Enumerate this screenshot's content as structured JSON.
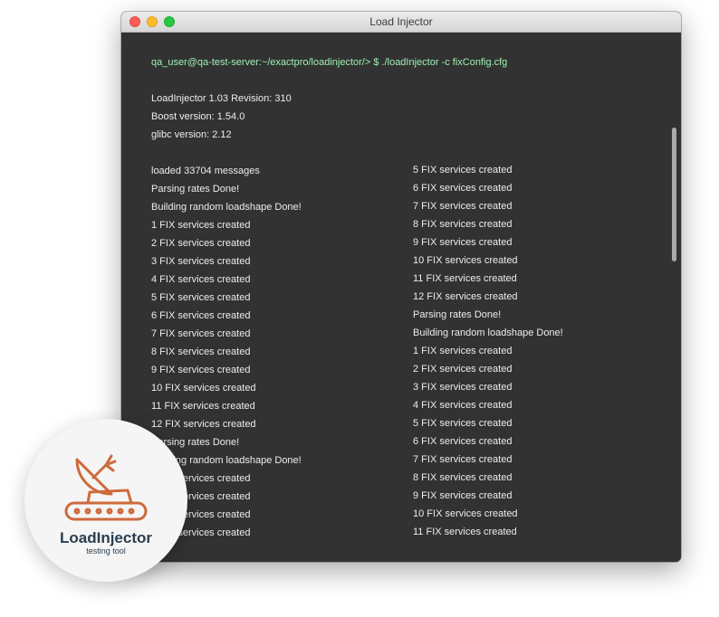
{
  "window": {
    "title": "Load Injector"
  },
  "terminal": {
    "prompt": "qa_user@qa-test-server:~/exactpro/loadinjector/> $ ./loadInjector -c fixConfig.cfg",
    "info": [
      "LoadInjector 1.03 Revision: 310",
      "Boost version: 1.54.0",
      "glibc version: 2.12"
    ],
    "left_column": [
      "loaded 33704 messages",
      "Parsing rates Done!",
      "Building random loadshape Done!",
      "1 FIX services created",
      "2 FIX services created",
      "3 FIX services created",
      "4 FIX services created",
      "5 FIX services created",
      "6 FIX services created",
      "7 FIX services created",
      "8 FIX services created",
      "9 FIX services created",
      "10 FIX services created",
      "11 FIX services created",
      "12 FIX services created",
      "Parsing rates Done!",
      "Building random loadshape Done!",
      "1 FIX services created",
      "2 FIX services created",
      "3 FIX services created",
      "4 FIX services created"
    ],
    "right_column": [
      "5 FIX services created",
      "6 FIX services created",
      "7 FIX services created",
      "8 FIX services created",
      "9 FIX services created",
      "10 FIX services created",
      "11 FIX services created",
      "12 FIX services created",
      "Parsing rates Done!",
      "Building random loadshape Done!",
      "1 FIX services created",
      "2 FIX services created",
      "3 FIX services created",
      "4 FIX services created",
      "5 FIX services created",
      "6 FIX services created",
      "7 FIX services created",
      "8 FIX services created",
      "9 FIX services created",
      "10 FIX services created",
      "11 FIX services created"
    ]
  },
  "logo": {
    "name": "LoadInjector",
    "tagline": "testing tool",
    "icon": "satellite-dish-tank-icon"
  },
  "colors": {
    "prompt": "#9ef0b2",
    "terminal_bg": "#323232",
    "logo_accent": "#cf6a3c",
    "logo_text": "#2b3f50"
  }
}
